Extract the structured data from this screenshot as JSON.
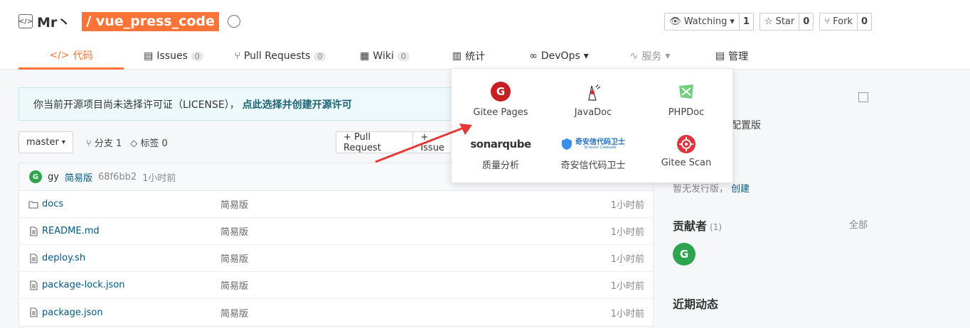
{
  "header": {
    "owner": "Mr丶",
    "repo_name": "/ vue_press_code",
    "actions": [
      {
        "label": "Watching",
        "count": "1",
        "icon": "eye-icon"
      },
      {
        "label": "Star",
        "count": "0",
        "icon": "star-icon"
      },
      {
        "label": "Fork",
        "count": "0",
        "icon": "fork-icon"
      }
    ]
  },
  "tabs": [
    {
      "label": "代码",
      "icon": "code-icon"
    },
    {
      "label": "Issues",
      "count": "0"
    },
    {
      "label": "Pull Requests",
      "count": "0"
    },
    {
      "label": "Wiki",
      "count": "0"
    },
    {
      "label": "统计"
    },
    {
      "label": "DevOps"
    },
    {
      "label": "服务"
    },
    {
      "label": "管理"
    }
  ],
  "license": {
    "text": "你当前开源项目尚未选择许可证（LICENSE），",
    "link": "点此选择并创建开源许可"
  },
  "branch": {
    "name": "master",
    "branches": "分支 1",
    "tags": "标签 0"
  },
  "buttons": {
    "pull_request": "+ Pull Request",
    "issue": "+ Issue"
  },
  "commit": {
    "avatar": "G",
    "author": "gy",
    "message": "简易版",
    "hash": "68f6bb2",
    "time": "1小时前"
  },
  "files": [
    {
      "name": "docs",
      "type": "folder",
      "message": "简易版",
      "time": "1小时前"
    },
    {
      "name": "README.md",
      "type": "file",
      "message": "简易版",
      "time": "1小时前"
    },
    {
      "name": "deploy.sh",
      "type": "file",
      "message": "简易版",
      "time": "1小时前"
    },
    {
      "name": "package-lock.json",
      "type": "file",
      "message": "简易版",
      "time": "1小时前"
    },
    {
      "name": "package.json",
      "type": "file",
      "message": "简易版",
      "time": "1小时前"
    }
  ],
  "side": {
    "intro_tail": "配置版",
    "release_text": "暂无发行版，",
    "release_link": "创建",
    "contributors_title": "贡献者",
    "contributors_count": "(1)",
    "all": "全部",
    "contributor_avatar": "G",
    "recent_title": "近期动态"
  },
  "dropdown": {
    "items": [
      {
        "label": "Gitee Pages",
        "icon": "gitee-icon"
      },
      {
        "label": "JavaDoc",
        "icon": "java-duke-icon"
      },
      {
        "label": "PHPDoc",
        "icon": "phpdoc-icon"
      },
      {
        "label": "质量分析",
        "icon": "sonarqube-logo",
        "logo_text": "sonarqube"
      },
      {
        "label": "奇安信代码卫士",
        "icon": "qianxin-logo",
        "logo_text": "奇安信代码卫士",
        "logo_sub": "Qi'anxin Codesafe"
      },
      {
        "label": "Gitee Scan",
        "icon": "gitee-scan-icon"
      }
    ]
  },
  "colors": {
    "accent": "#fc7337",
    "link": "#005980",
    "gitee_red": "#c71d23",
    "contributor_green": "#2ea44f"
  }
}
